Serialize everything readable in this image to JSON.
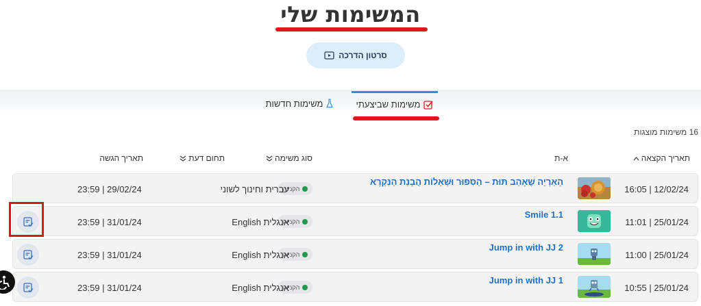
{
  "header": {
    "title": "המשימות שלי",
    "tutorial_button": "סרטון הדרכה"
  },
  "tabs": {
    "done": "משימות שביצעתי",
    "new": "משימות חדשות"
  },
  "summary": {
    "count_text": "16 משימות מוצגות"
  },
  "table": {
    "headers": {
      "assign_date": "תאריך הקצאה",
      "name": "א-ת",
      "type": "סוג משימה",
      "subject": "תחום דעת",
      "submit_date": "תאריך הגשה"
    },
    "rows": [
      {
        "assigned": "16:05 | 12/02/24",
        "name": "הָאַרְיֵה שֶׁאָהַב תּוּת – הַסִּפּוּר וּשְׁאֵלוֹת הֲבָנַת הַנִּקְרָא",
        "type": "הקנייה",
        "subject": "עברית וחינוך לשוני",
        "submit": "23:59 | 29/02/24",
        "thumb": "lion-strawberry"
      },
      {
        "assigned": "11:01 | 25/01/24",
        "name": "Smile 1.1",
        "type": "הקנייה",
        "subject": "אנגלית English",
        "submit": "23:59 | 31/01/24",
        "thumb": "green-smile"
      },
      {
        "assigned": "11:00 | 25/01/24",
        "name": "Jump in with JJ 2",
        "type": "הקנייה",
        "subject": "אנגלית English",
        "submit": "23:59 | 31/01/24",
        "thumb": "robot-field"
      },
      {
        "assigned": "10:55 | 25/01/24",
        "name": "Jump in with JJ 1",
        "type": "הקנייה",
        "subject": "אנגלית English",
        "submit": "23:59 | 31/01/24",
        "thumb": "robot-trampoline"
      }
    ]
  },
  "icons": {
    "tutorial": "play-icon",
    "tab_done": "checkbox-icon",
    "tab_new": "flask-icon",
    "action": "task-check-icon",
    "accessibility": "accessibility-icon"
  },
  "colors": {
    "accent_red": "#e0161d",
    "link_blue": "#1f6fc5",
    "tab_blue": "#2a8fd6",
    "status_green": "#1a9a4a"
  }
}
